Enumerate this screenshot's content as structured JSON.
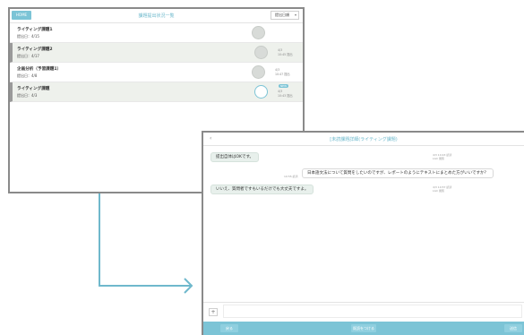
{
  "list_screen": {
    "home_label": "HOME",
    "title": "課題提出状況一覧",
    "filter_value": "提出日順",
    "rows": [
      {
        "title": "ライティング課題1",
        "sub": "提出日：4/15",
        "circle": "",
        "meta": [
          "",
          ""
        ],
        "badge": ""
      },
      {
        "title": "ライティング課題2",
        "sub": "提出日：4/17",
        "circle": "",
        "meta": [
          "4/3",
          "10:45 提出"
        ],
        "badge": ""
      },
      {
        "title": "企画分析（予習課題1）",
        "sub": "提出日：4/8",
        "circle": "",
        "meta": [
          "4/3",
          "10:47 提出"
        ],
        "badge": ""
      },
      {
        "title": "ライティング課題",
        "sub": "提出日：4/3",
        "circle": "",
        "meta": [
          "4/3",
          "10:43 提出"
        ],
        "badge": "NEW"
      }
    ]
  },
  "chat_screen": {
    "back_label": "‹",
    "title": "[未読課題詳細(ライティング課題)",
    "messages": [
      {
        "side": "left",
        "text": "提出自体はOKです。",
        "stamp": [
          "4/3 10:43 読済",
          "LGC 閲覧"
        ]
      },
      {
        "side": "right",
        "text": "日本語文法について質問をしたいのですが、レポートのようにテキストにまとめた方がいいですか？",
        "stamp": [
          "10:55 読済",
          ""
        ]
      },
      {
        "side": "left",
        "text": "いいえ、質問者ですもいるだけでも大丈夫ですよ。",
        "stamp": [
          "4/3 10:57 読済",
          "LGC 閲覧"
        ]
      }
    ],
    "plus_label": "+",
    "bottom": {
      "left": "戻る",
      "mid": "既読をつける",
      "right": "送信"
    }
  }
}
